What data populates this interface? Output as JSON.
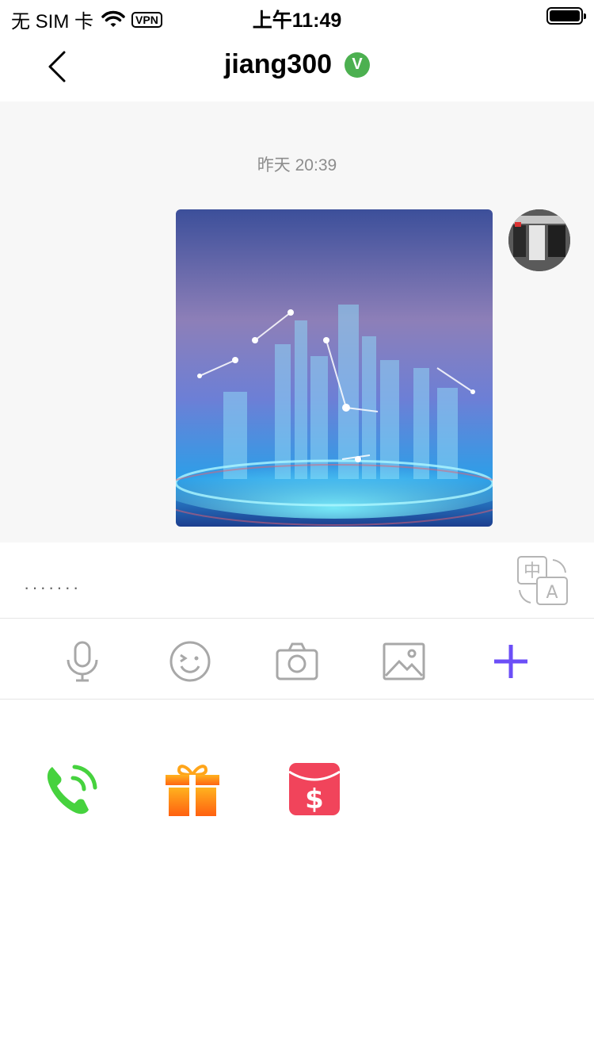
{
  "status_bar": {
    "carrier": "无 SIM 卡",
    "vpn": "VPN",
    "time": "上午11:49",
    "battery_level": 1.0
  },
  "nav": {
    "title": "jiang300",
    "verified_badge": "V"
  },
  "chat": {
    "timestamp": "昨天 20:39"
  },
  "input": {
    "value": "·······",
    "translate_labels": [
      "中",
      "A"
    ]
  },
  "toolbar": {
    "icons": [
      "microphone-icon",
      "emoji-icon",
      "camera-icon",
      "image-icon",
      "plus-icon"
    ],
    "accent_color": "#6b4ef7"
  },
  "panel": {
    "icons": [
      "phone-call-icon",
      "gift-icon",
      "red-packet-icon"
    ]
  },
  "colors": {
    "verified": "#4cb050",
    "phone": "#46d23e",
    "gift": "#ff7a12",
    "red_packet": "#f1445b",
    "icon_gray": "#a8a8a8"
  }
}
